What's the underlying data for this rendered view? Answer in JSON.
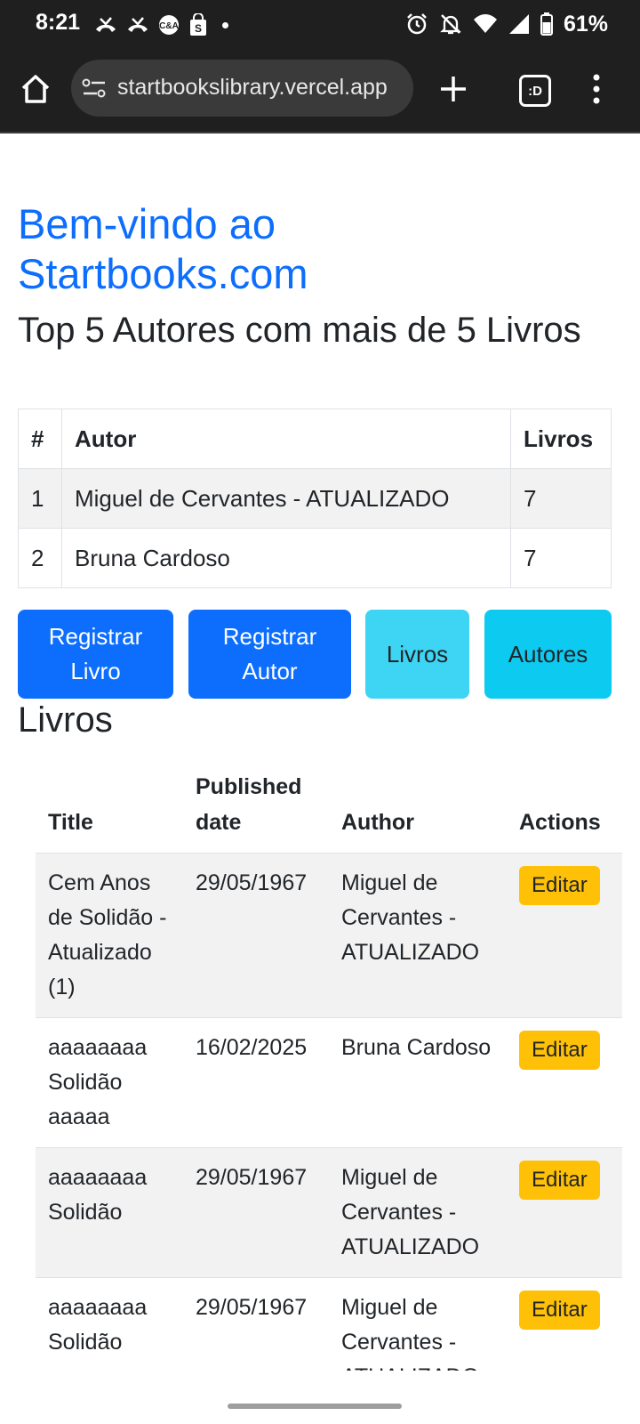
{
  "status_bar": {
    "time": "8:21",
    "battery": "61%",
    "icons": [
      "missed-call-icon",
      "missed-call-icon",
      "ca-app-icon",
      "shopping-bag-icon",
      "notification-dot",
      "alarm-icon",
      "bell-off-icon",
      "wifi-icon",
      "signal-icon",
      "battery-icon"
    ]
  },
  "browser": {
    "url": "startbookslibrary.vercel.app",
    "tabs_label": ":D"
  },
  "page": {
    "welcome": "Bem-vindo ao Startbooks.com",
    "top_title": "Top 5 Autores com mais de 5 Livros",
    "authors_table": {
      "headers": [
        "#",
        "Autor",
        "Livros"
      ],
      "rows": [
        [
          "1",
          "Miguel de Cervantes - ATUALIZADO",
          "7"
        ],
        [
          "2",
          "Bruna Cardoso",
          "7"
        ]
      ]
    },
    "buttons": {
      "register_book": "Registrar Livro",
      "register_author": "Registrar Autor",
      "books": "Livros",
      "authors": "Autores"
    },
    "books_title": "Livros",
    "books_table": {
      "headers": [
        "Title",
        "Published date",
        "Author",
        "Actions"
      ],
      "rows": [
        {
          "title": "Cem Anos de Solidão - Atualizado (1)",
          "date": "29/05/1967",
          "author": "Miguel de Cervantes - ATUALIZADO",
          "action": "Editar"
        },
        {
          "title": "aaaaaaaa Solidão aaaaa",
          "date": "16/02/2025",
          "author": "Bruna Cardoso",
          "action": "Editar"
        },
        {
          "title": "aaaaaaaa Solidão",
          "date": "29/05/1967",
          "author": "Miguel de Cervantes - ATUALIZADO",
          "action": "Editar"
        },
        {
          "title": "aaaaaaaa Solidão",
          "date": "29/05/1967",
          "author": "Miguel de Cervantes - ATUALIZADO",
          "action": "Editar"
        }
      ]
    }
  },
  "colors": {
    "primary": "#0d6efd",
    "info": "#0dcaf0",
    "warning": "#ffc107",
    "browser_chrome": "#1f1f1f"
  }
}
